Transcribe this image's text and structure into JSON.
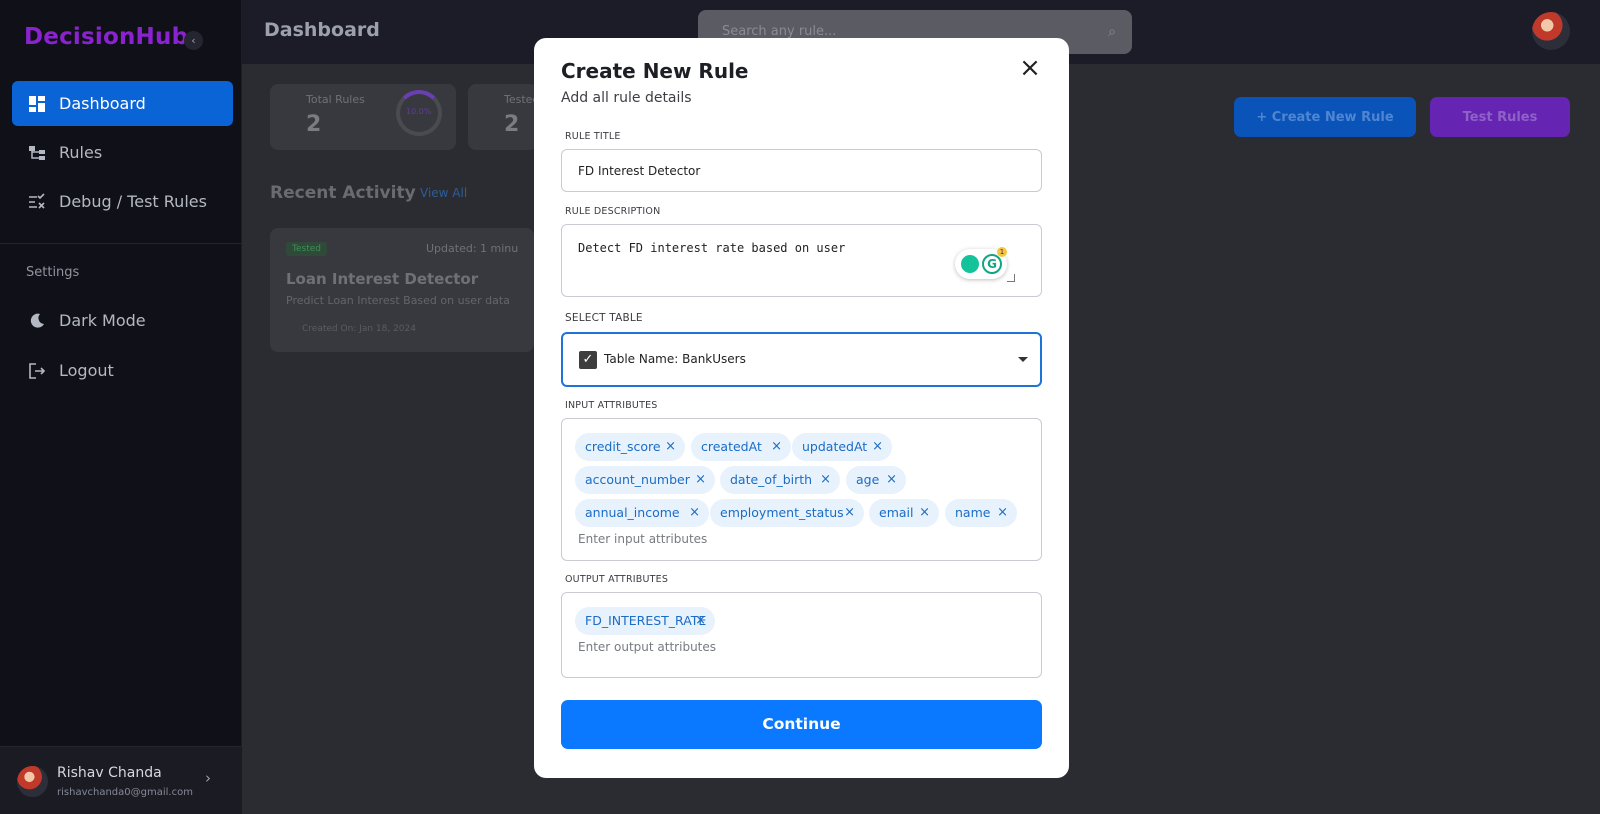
{
  "app": {
    "brand": "DecisionHub",
    "collapse_icon": "‹"
  },
  "sidebar": {
    "items": [
      {
        "label": "Dashboard",
        "icon": "dashboard-icon"
      },
      {
        "label": "Rules",
        "icon": "rules-icon"
      },
      {
        "label": "Debug / Test Rules",
        "icon": "debug-icon"
      }
    ],
    "section_label": "Settings",
    "settings_items": [
      {
        "label": "Dark Mode",
        "icon": "moon-icon"
      },
      {
        "label": "Logout",
        "icon": "logout-icon"
      }
    ],
    "user": {
      "name": "Rishav Chanda",
      "email": "rishavchanda0@gmail.com",
      "chevron": "›"
    }
  },
  "header": {
    "title": "Dashboard",
    "search_placeholder": "Search any rule...",
    "search_icon": "⌕"
  },
  "stats": [
    {
      "label": "Total Rules",
      "value": "2",
      "ring_text": "10.0%"
    },
    {
      "label": "Tested",
      "value": "2"
    }
  ],
  "recent": {
    "title": "Recent Activity",
    "view_all": "View All",
    "card": {
      "badge": "Tested",
      "updated": "Updated: 1 minu",
      "title": "Loan Interest Detector",
      "description": "Predict Loan Interest Based on user data",
      "created": "Created On: Jan 18, 2024"
    }
  },
  "actions": {
    "create_label": "+ Create New Rule",
    "test_label": "Test Rules"
  },
  "modal": {
    "title": "Create New Rule",
    "subtitle": "Add all rule details",
    "close": "×",
    "rule_title_label": "RULE TITLE",
    "rule_title_value": "FD Interest Detector",
    "rule_description_label": "RULE DESCRIPTION",
    "rule_description_value": "Detect FD interest rate based on user",
    "grammarly_badge": "1",
    "grammarly_letter": "G",
    "select_table_label": "SELECT TABLE",
    "select_table_value": "Table Name: BankUsers",
    "select_check": "✓",
    "input_attributes_label": "INPUT ATTRIBUTES",
    "input_attributes": [
      "credit_score",
      "createdAt",
      "updatedAt",
      "account_number",
      "date_of_birth",
      "age",
      "annual_income",
      "employment_status",
      "email",
      "name"
    ],
    "input_placeholder": "Enter input attributes",
    "output_attributes_label": "OUTPUT ATTRIBUTES",
    "output_attributes": [
      "FD_INTEREST_RATE"
    ],
    "output_placeholder": "Enter output attributes",
    "chip_remove": "×",
    "continue_label": "Continue"
  }
}
